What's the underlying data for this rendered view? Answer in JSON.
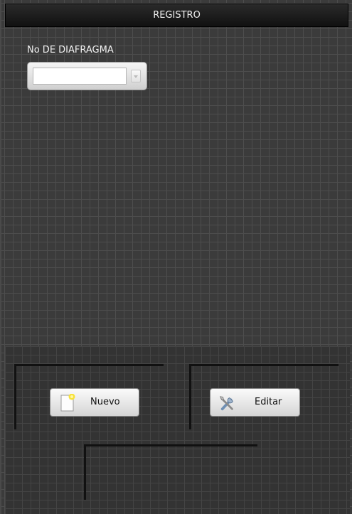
{
  "window": {
    "title": "REGISTRO"
  },
  "form": {
    "field_label": "No DE DIAFRAGMA",
    "field_value": ""
  },
  "buttons": {
    "new_label": "Nuevo",
    "edit_label": "Editar"
  },
  "icons": {
    "new": "new-document-icon",
    "edit": "tools-icon"
  }
}
